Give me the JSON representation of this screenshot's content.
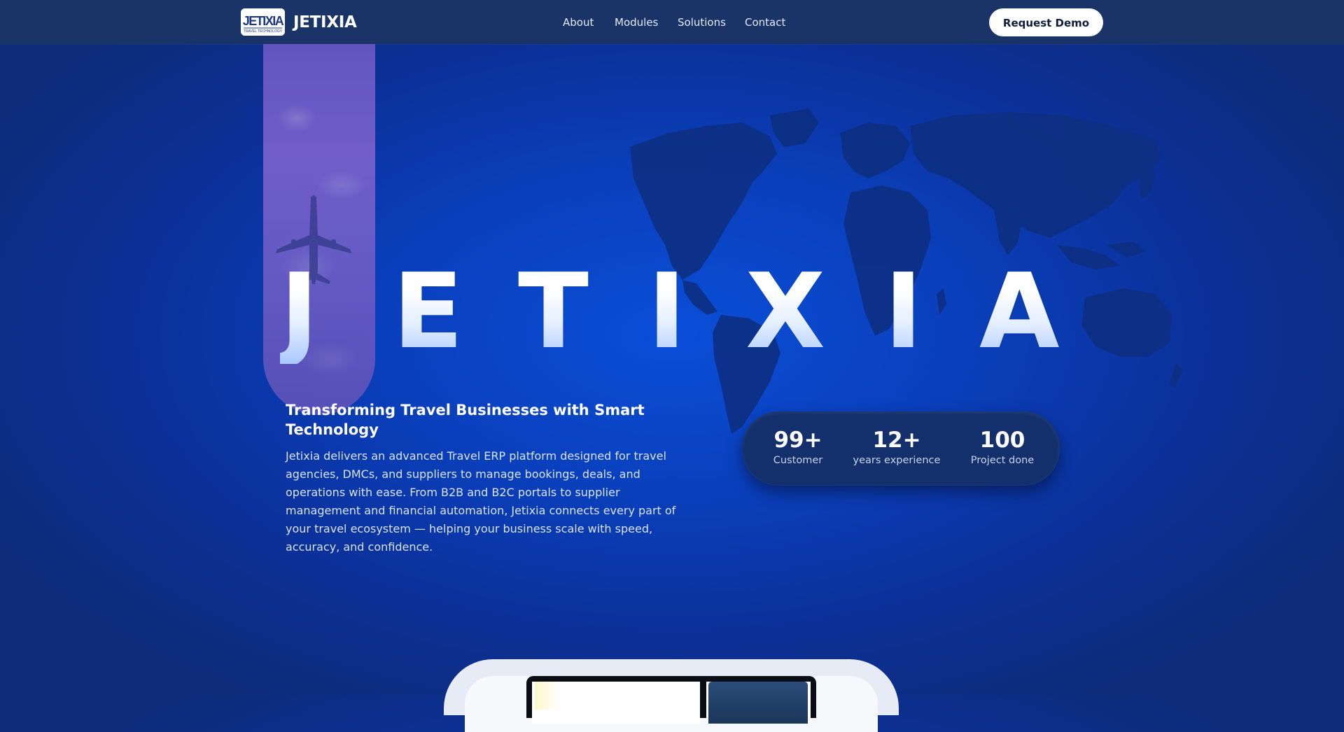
{
  "header": {
    "logo_text": "JETIXIA",
    "logo_tagline": "TRAVEL TECHNOLOGY",
    "brand": "JETIXIA",
    "nav": [
      {
        "label": "About"
      },
      {
        "label": "Modules"
      },
      {
        "label": "Solutions"
      },
      {
        "label": "Contact"
      }
    ],
    "cta_label": "Request Demo"
  },
  "hero": {
    "big_letters": [
      "J",
      "E",
      "T",
      "I",
      "X",
      "I",
      "A"
    ],
    "title": "Transforming Travel Businesses with Smart Technology",
    "description": "Jetixia delivers an advanced Travel ERP platform designed for travel agencies, DMCs, and suppliers to manage bookings, deals, and operations with ease. From B2B and B2C portals to supplier management and financial automation, Jetixia connects every part of your travel ecosystem — helping your business scale with speed, accuracy, and confidence."
  },
  "stats": [
    {
      "value": "99+",
      "label": "Customer"
    },
    {
      "value": "12+",
      "label": "years experience"
    },
    {
      "value": "100",
      "label": "Project done"
    }
  ],
  "colors": {
    "header_bg": "#1b3468",
    "page_bg": "#0a4ed8",
    "stats_bg": "#14306c",
    "cta_bg": "#ffffff"
  },
  "icons": [
    "jetixia-logo-icon",
    "airplane-icon",
    "world-map-icon"
  ]
}
